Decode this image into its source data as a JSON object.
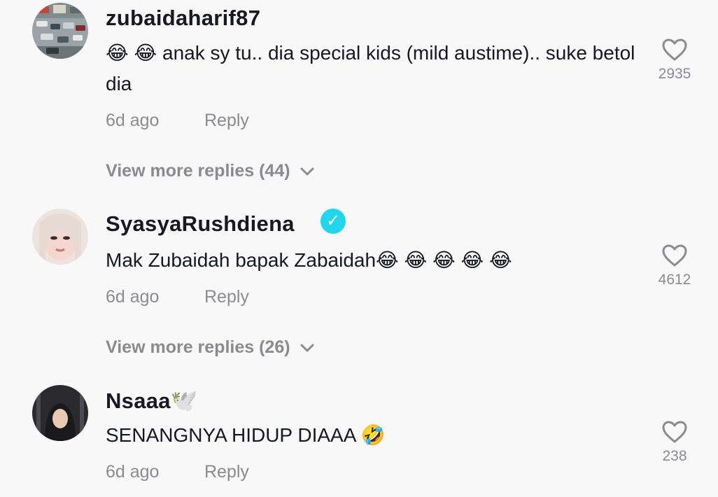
{
  "comments": [
    {
      "username": "zubaidaharif87",
      "text": "😂 😂 anak sy tu.. dia special kids (mild austime).. suke betol dia",
      "time": "6d ago",
      "reply_label": "Reply",
      "likes": "2935",
      "view_more": "View more replies (44)",
      "avatar": "parking-lot-photo"
    },
    {
      "username": "SyasyaRushdiena",
      "verified": true,
      "text": "Mak Zubaidah bapak Zabaidah😂 😂 😂 😂 😂",
      "time": "6d ago",
      "reply_label": "Reply",
      "likes": "4612",
      "view_more": "View more replies (26)",
      "avatar": "woman-portrait"
    },
    {
      "username": "Nsaaa🕊️",
      "text": "SENANGNYA HIDUP DIAAA 🤣",
      "time": "6d ago",
      "reply_label": "Reply",
      "likes": "238",
      "avatar": "hijab-woman-portrait"
    }
  ],
  "colors": {
    "background": "#f8f8f8",
    "primary_text": "#161823",
    "secondary_text": "#8a8b91",
    "verified_badge": "#20d5ec"
  }
}
